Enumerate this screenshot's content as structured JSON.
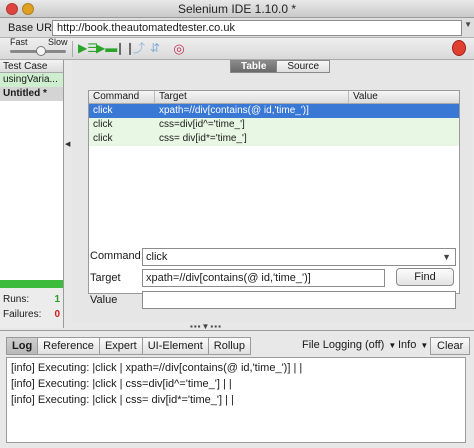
{
  "window": {
    "title": "Selenium IDE 1.10.0 *"
  },
  "base_url": {
    "label": "Base URL",
    "value": "http://book.theautomatedtester.co.uk"
  },
  "toolbar": {
    "fast_label": "Fast",
    "slow_label": "Slow",
    "speed_level": 0.5
  },
  "left_panel": {
    "header": "Test Case",
    "items": [
      {
        "label": "usingVaria..."
      },
      {
        "label": "Untitled *"
      }
    ]
  },
  "stats": {
    "runs_label": "Runs:",
    "runs_value": "1",
    "failures_label": "Failures:",
    "failures_value": "0"
  },
  "view_tabs": [
    {
      "label": "Table"
    },
    {
      "label": "Source"
    }
  ],
  "table": {
    "headers": {
      "command": "Command",
      "target": "Target",
      "value": "Value"
    },
    "rows": [
      {
        "command": "click",
        "target": "xpath=//div[contains(@ id,'time_')]",
        "value": ""
      },
      {
        "command": "click",
        "target": "css=div[id^='time_']",
        "value": ""
      },
      {
        "command": "click",
        "target": "css= div[id*='time_']",
        "value": ""
      }
    ]
  },
  "form": {
    "command_label": "Command",
    "command_value": "click",
    "target_label": "Target",
    "target_value": "xpath=//div[contains(@ id,'time_')]",
    "value_label": "Value",
    "value_value": "",
    "find_label": "Find"
  },
  "log": {
    "tabs": [
      {
        "label": "Log"
      },
      {
        "label": "Reference"
      },
      {
        "label": "Expert"
      },
      {
        "label": "UI-Element"
      },
      {
        "label": "Rollup"
      }
    ],
    "file_logging": "File Logging (off)",
    "level": "Info",
    "clear_label": "Clear",
    "lines": [
      "[info] Executing: |click | xpath=//div[contains(@ id,'time_')] | |",
      "[info] Executing: |click | css=div[id^='time_'] | |",
      "[info] Executing: |click | css= div[id*='time_'] | |"
    ]
  }
}
